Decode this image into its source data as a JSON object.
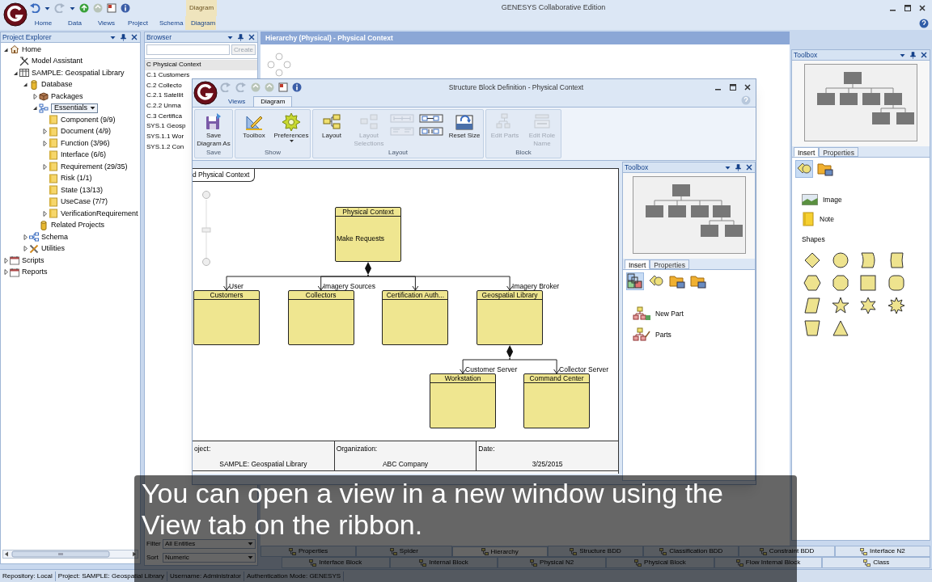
{
  "app": {
    "title": "GENESYS Collaborative Edition",
    "contextual_group": "Diagram",
    "tabs": [
      {
        "label": "Home",
        "selected": false
      },
      {
        "label": "Data",
        "selected": false
      },
      {
        "label": "Views",
        "selected": false
      },
      {
        "label": "Project",
        "selected": false
      },
      {
        "label": "Schema",
        "selected": false
      },
      {
        "label": "Diagram",
        "selected": false
      }
    ]
  },
  "project_explorer": {
    "title": "Project Explorer",
    "tree": [
      {
        "label": "Home",
        "kind": "home",
        "expanded": true,
        "children": [
          {
            "label": "Model Assistant",
            "kind": "assistant"
          },
          {
            "label": "SAMPLE: Geospatial Library",
            "kind": "project",
            "expanded": true,
            "children": [
              {
                "label": "Database",
                "kind": "database",
                "expanded": true,
                "children": [
                  {
                    "label": "Packages",
                    "kind": "packages",
                    "expanded": false
                  },
                  {
                    "label": "Essentials",
                    "kind": "filter",
                    "expanded": true,
                    "children": [
                      {
                        "label": "Component  (9/9)",
                        "kind": "folder"
                      },
                      {
                        "label": "Document  (4/9)",
                        "kind": "folder",
                        "expanded": false
                      },
                      {
                        "label": "Function  (3/96)",
                        "kind": "folder",
                        "expanded": false
                      },
                      {
                        "label": "Interface  (6/6)",
                        "kind": "folder"
                      },
                      {
                        "label": "Requirement  (29/35)",
                        "kind": "folder",
                        "expanded": false
                      },
                      {
                        "label": "Risk  (1/1)",
                        "kind": "folder"
                      },
                      {
                        "label": "State  (13/13)",
                        "kind": "folder"
                      },
                      {
                        "label": "UseCase  (7/7)",
                        "kind": "folder"
                      },
                      {
                        "label": "VerificationRequirement",
                        "kind": "folder",
                        "expanded": false
                      }
                    ]
                  },
                  {
                    "label": "Related Projects",
                    "kind": "database"
                  }
                ]
              },
              {
                "label": "Schema",
                "kind": "schema",
                "expanded": false
              },
              {
                "label": "Utilities",
                "kind": "utilities",
                "expanded": false
              }
            ]
          }
        ]
      },
      {
        "label": "Scripts",
        "kind": "scripts",
        "expanded": false
      },
      {
        "label": "Reports",
        "kind": "scripts",
        "expanded": false
      }
    ]
  },
  "browser": {
    "title": "Browser",
    "create_button": {
      "label": "Create",
      "disabled": true
    },
    "items": [
      {
        "label": "C Physical Context",
        "selected": true
      },
      {
        "label": "C.1 Customers",
        "selected": false
      },
      {
        "label": "C.2 Collecto",
        "selected": false
      },
      {
        "label": "C.2.1 Satellit",
        "selected": false
      },
      {
        "label": "C.2.2 Unma",
        "selected": false
      },
      {
        "label": "C.3 Certifica",
        "selected": false
      },
      {
        "label": "SYS.1 Geosp",
        "selected": false
      },
      {
        "label": "SYS.1.1 Wor",
        "selected": false
      },
      {
        "label": "SYS.1.2 Con",
        "selected": false
      }
    ],
    "filter": {
      "label": "Filter",
      "value": "All Entities"
    },
    "sort": {
      "label": "Sort",
      "value": "Numeric"
    }
  },
  "document": {
    "title": "Hierarchy (Physical) - Physical Context"
  },
  "toolbox": {
    "title": "Toolbox",
    "tabs": [
      {
        "label": "Insert",
        "selected": true
      },
      {
        "label": "Properties",
        "selected": false
      }
    ],
    "tool_icons": [
      {
        "selected": true
      },
      {
        "selected": false
      }
    ],
    "items": [
      "Image",
      "Note"
    ],
    "shapes_heading": "Shapes"
  },
  "structure_window": {
    "title": "Structure Block Definition - Physical Context",
    "tabs": [
      {
        "label": "Views",
        "selected": false
      },
      {
        "label": "Diagram",
        "selected": true
      }
    ],
    "ribbon_groups": [
      {
        "label": "Save",
        "buttons": [
          {
            "kind": "large",
            "label": "Save Diagram As",
            "disabled": false
          }
        ]
      },
      {
        "label": "Show",
        "buttons": [
          {
            "kind": "large",
            "label": "Toolbox",
            "disabled": false
          },
          {
            "kind": "large",
            "label": "Preferences",
            "disabled": false,
            "dropdown": true
          }
        ]
      },
      {
        "label": "Layout",
        "buttons": [
          {
            "kind": "large",
            "label": "Layout",
            "disabled": false
          },
          {
            "kind": "large",
            "label": "Layout Selections",
            "disabled": true
          },
          {
            "kind": "small",
            "disabled": true
          },
          {
            "kind": "small",
            "disabled": true
          },
          {
            "kind": "small",
            "disabled": false
          },
          {
            "kind": "small",
            "disabled": false
          },
          {
            "kind": "large",
            "label": "Reset Size",
            "disabled": false
          }
        ]
      },
      {
        "label": "Block",
        "buttons": [
          {
            "kind": "large",
            "label": "Edit Parts",
            "disabled": true
          },
          {
            "kind": "large",
            "label": "Edit Role Name",
            "disabled": true
          }
        ]
      }
    ],
    "diagram": {
      "frame_label": "d Physical Context",
      "zoom_slider": {
        "level": 0.5
      },
      "root": {
        "name": "Physical Context",
        "body": "Make Requests",
        "children": [
          {
            "name": "Customers",
            "role": "User"
          },
          {
            "name": "Collectors",
            "role": "Imagery Sources"
          },
          {
            "name": "Certification Auth..."
          },
          {
            "name": "Geospatial Library",
            "role": "Imagery Broker",
            "children": [
              {
                "name": "Workstation",
                "role": "Customer Server"
              },
              {
                "name": "Command Center",
                "role": "Collector Server"
              }
            ]
          }
        ]
      },
      "title_block": [
        {
          "label": "oject:",
          "value": "SAMPLE: Geospatial Library"
        },
        {
          "label": "Organization:",
          "value": "ABC Company"
        },
        {
          "label": "Date:",
          "value": "3/25/2015"
        }
      ]
    },
    "toolbox": {
      "title": "Toolbox",
      "tabs": [
        {
          "label": "Insert",
          "selected": true
        },
        {
          "label": "Properties",
          "selected": false
        }
      ],
      "tool_icons": [
        {
          "selected": true
        },
        {
          "selected": false
        },
        {
          "selected": false
        },
        {
          "selected": false
        }
      ],
      "items": [
        "New Part",
        "Parts"
      ]
    }
  },
  "view_tabs": [
    {
      "tabs": [
        {
          "label": "Properties",
          "selected": false
        },
        {
          "label": "Spider",
          "selected": false
        },
        {
          "label": "Hierarchy",
          "selected": true
        },
        {
          "label": "Structure BDD",
          "selected": false
        },
        {
          "label": "Classification BDD",
          "selected": false
        },
        {
          "label": "Constraint BDD",
          "selected": false
        },
        {
          "label": "Interface N2",
          "selected": false
        }
      ]
    },
    {
      "tabs": [
        {
          "label": "Interface Block",
          "selected": false
        },
        {
          "label": "Internal Block",
          "selected": false
        },
        {
          "label": "Physical N2",
          "selected": false
        },
        {
          "label": "Physical Block",
          "selected": false
        },
        {
          "label": "Flow Internal Block",
          "selected": false
        },
        {
          "label": "Class",
          "selected": false
        }
      ]
    }
  ],
  "status_bar": [
    "Repository: Local",
    "Project: SAMPLE: Geospatial Library",
    "Username: Administrator",
    "Authentication Mode: GENESYS"
  ],
  "caption": "You can open a view in a new window using the View tab on the ribbon."
}
